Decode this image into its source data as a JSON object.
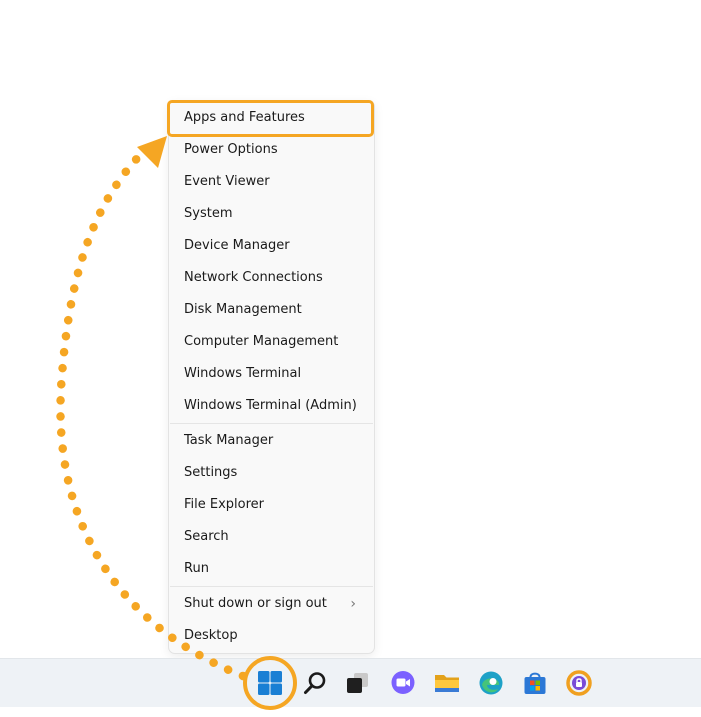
{
  "menu": {
    "items": [
      {
        "label": "Apps and Features"
      },
      {
        "label": "Power Options"
      },
      {
        "label": "Event Viewer"
      },
      {
        "label": "System"
      },
      {
        "label": "Device Manager"
      },
      {
        "label": "Network Connections"
      },
      {
        "label": "Disk Management"
      },
      {
        "label": "Computer Management"
      },
      {
        "label": "Windows Terminal"
      },
      {
        "label": "Windows Terminal (Admin)"
      },
      {
        "label": "Task Manager"
      },
      {
        "label": "Settings"
      },
      {
        "label": "File Explorer"
      },
      {
        "label": "Search"
      },
      {
        "label": "Run"
      },
      {
        "label": "Shut down or sign out",
        "submenu": true
      },
      {
        "label": "Desktop"
      }
    ],
    "highlighted_item": "Apps and Features",
    "submenu_chevron": "›"
  },
  "taskbar": {
    "icons": [
      "start-icon",
      "search-icon",
      "task-view-icon",
      "teams-chat-icon",
      "file-explorer-icon",
      "edge-icon",
      "store-icon",
      "security-app-icon"
    ]
  },
  "colors": {
    "annotation": "#F5A623",
    "start_blue": "#1A7FD4",
    "menu_bg": "#f9f9f9",
    "taskbar_bg": "#eef2f6"
  }
}
